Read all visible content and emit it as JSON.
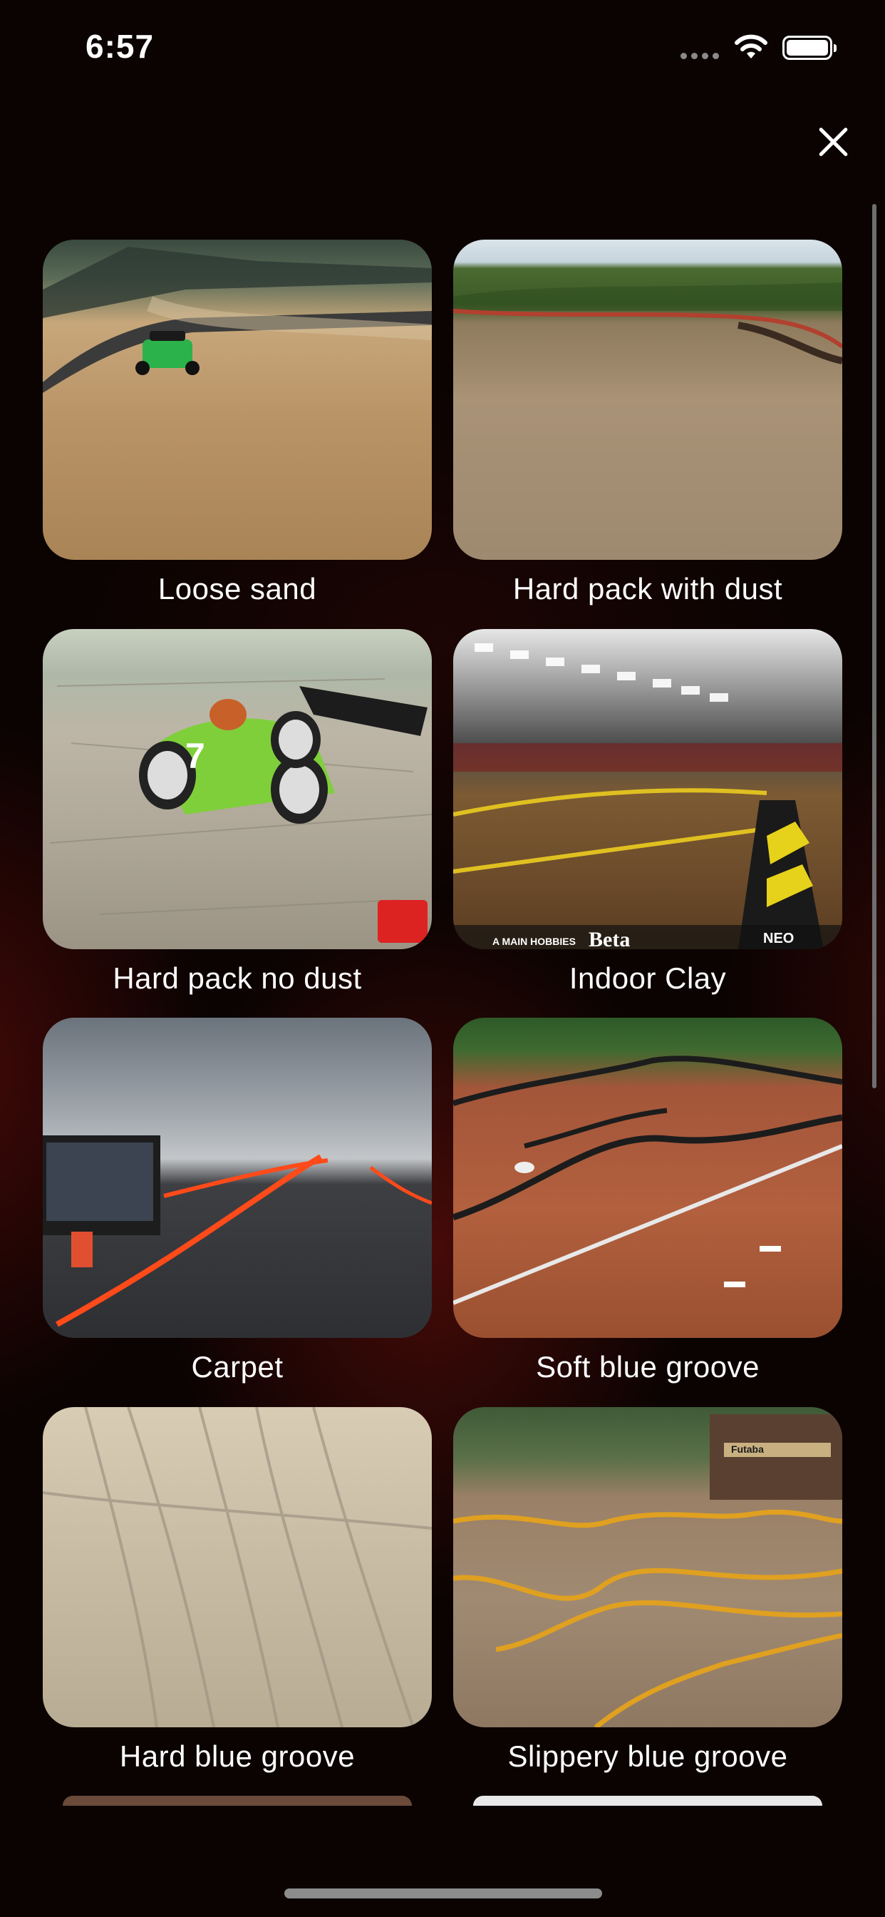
{
  "status_bar": {
    "time": "6:57"
  },
  "close_button": {
    "icon": "close-icon"
  },
  "surfaces": [
    {
      "label": "Loose sand"
    },
    {
      "label": "Hard pack with dust"
    },
    {
      "label": "Hard pack no dust"
    },
    {
      "label": "Indoor Clay"
    },
    {
      "label": "Carpet"
    },
    {
      "label": "Soft blue groove"
    },
    {
      "label": "Hard blue groove"
    },
    {
      "label": "Slippery blue groove"
    }
  ],
  "thumbnail_text": {
    "hard_pack_no_dust_car_number": "7",
    "indoor_clay_sponsor_1": "A MAIN HOBBIES",
    "indoor_clay_sponsor_2": "Beta",
    "indoor_clay_sponsor_3": "NEO",
    "slippery_blue_groove_sign": "Futaba"
  }
}
